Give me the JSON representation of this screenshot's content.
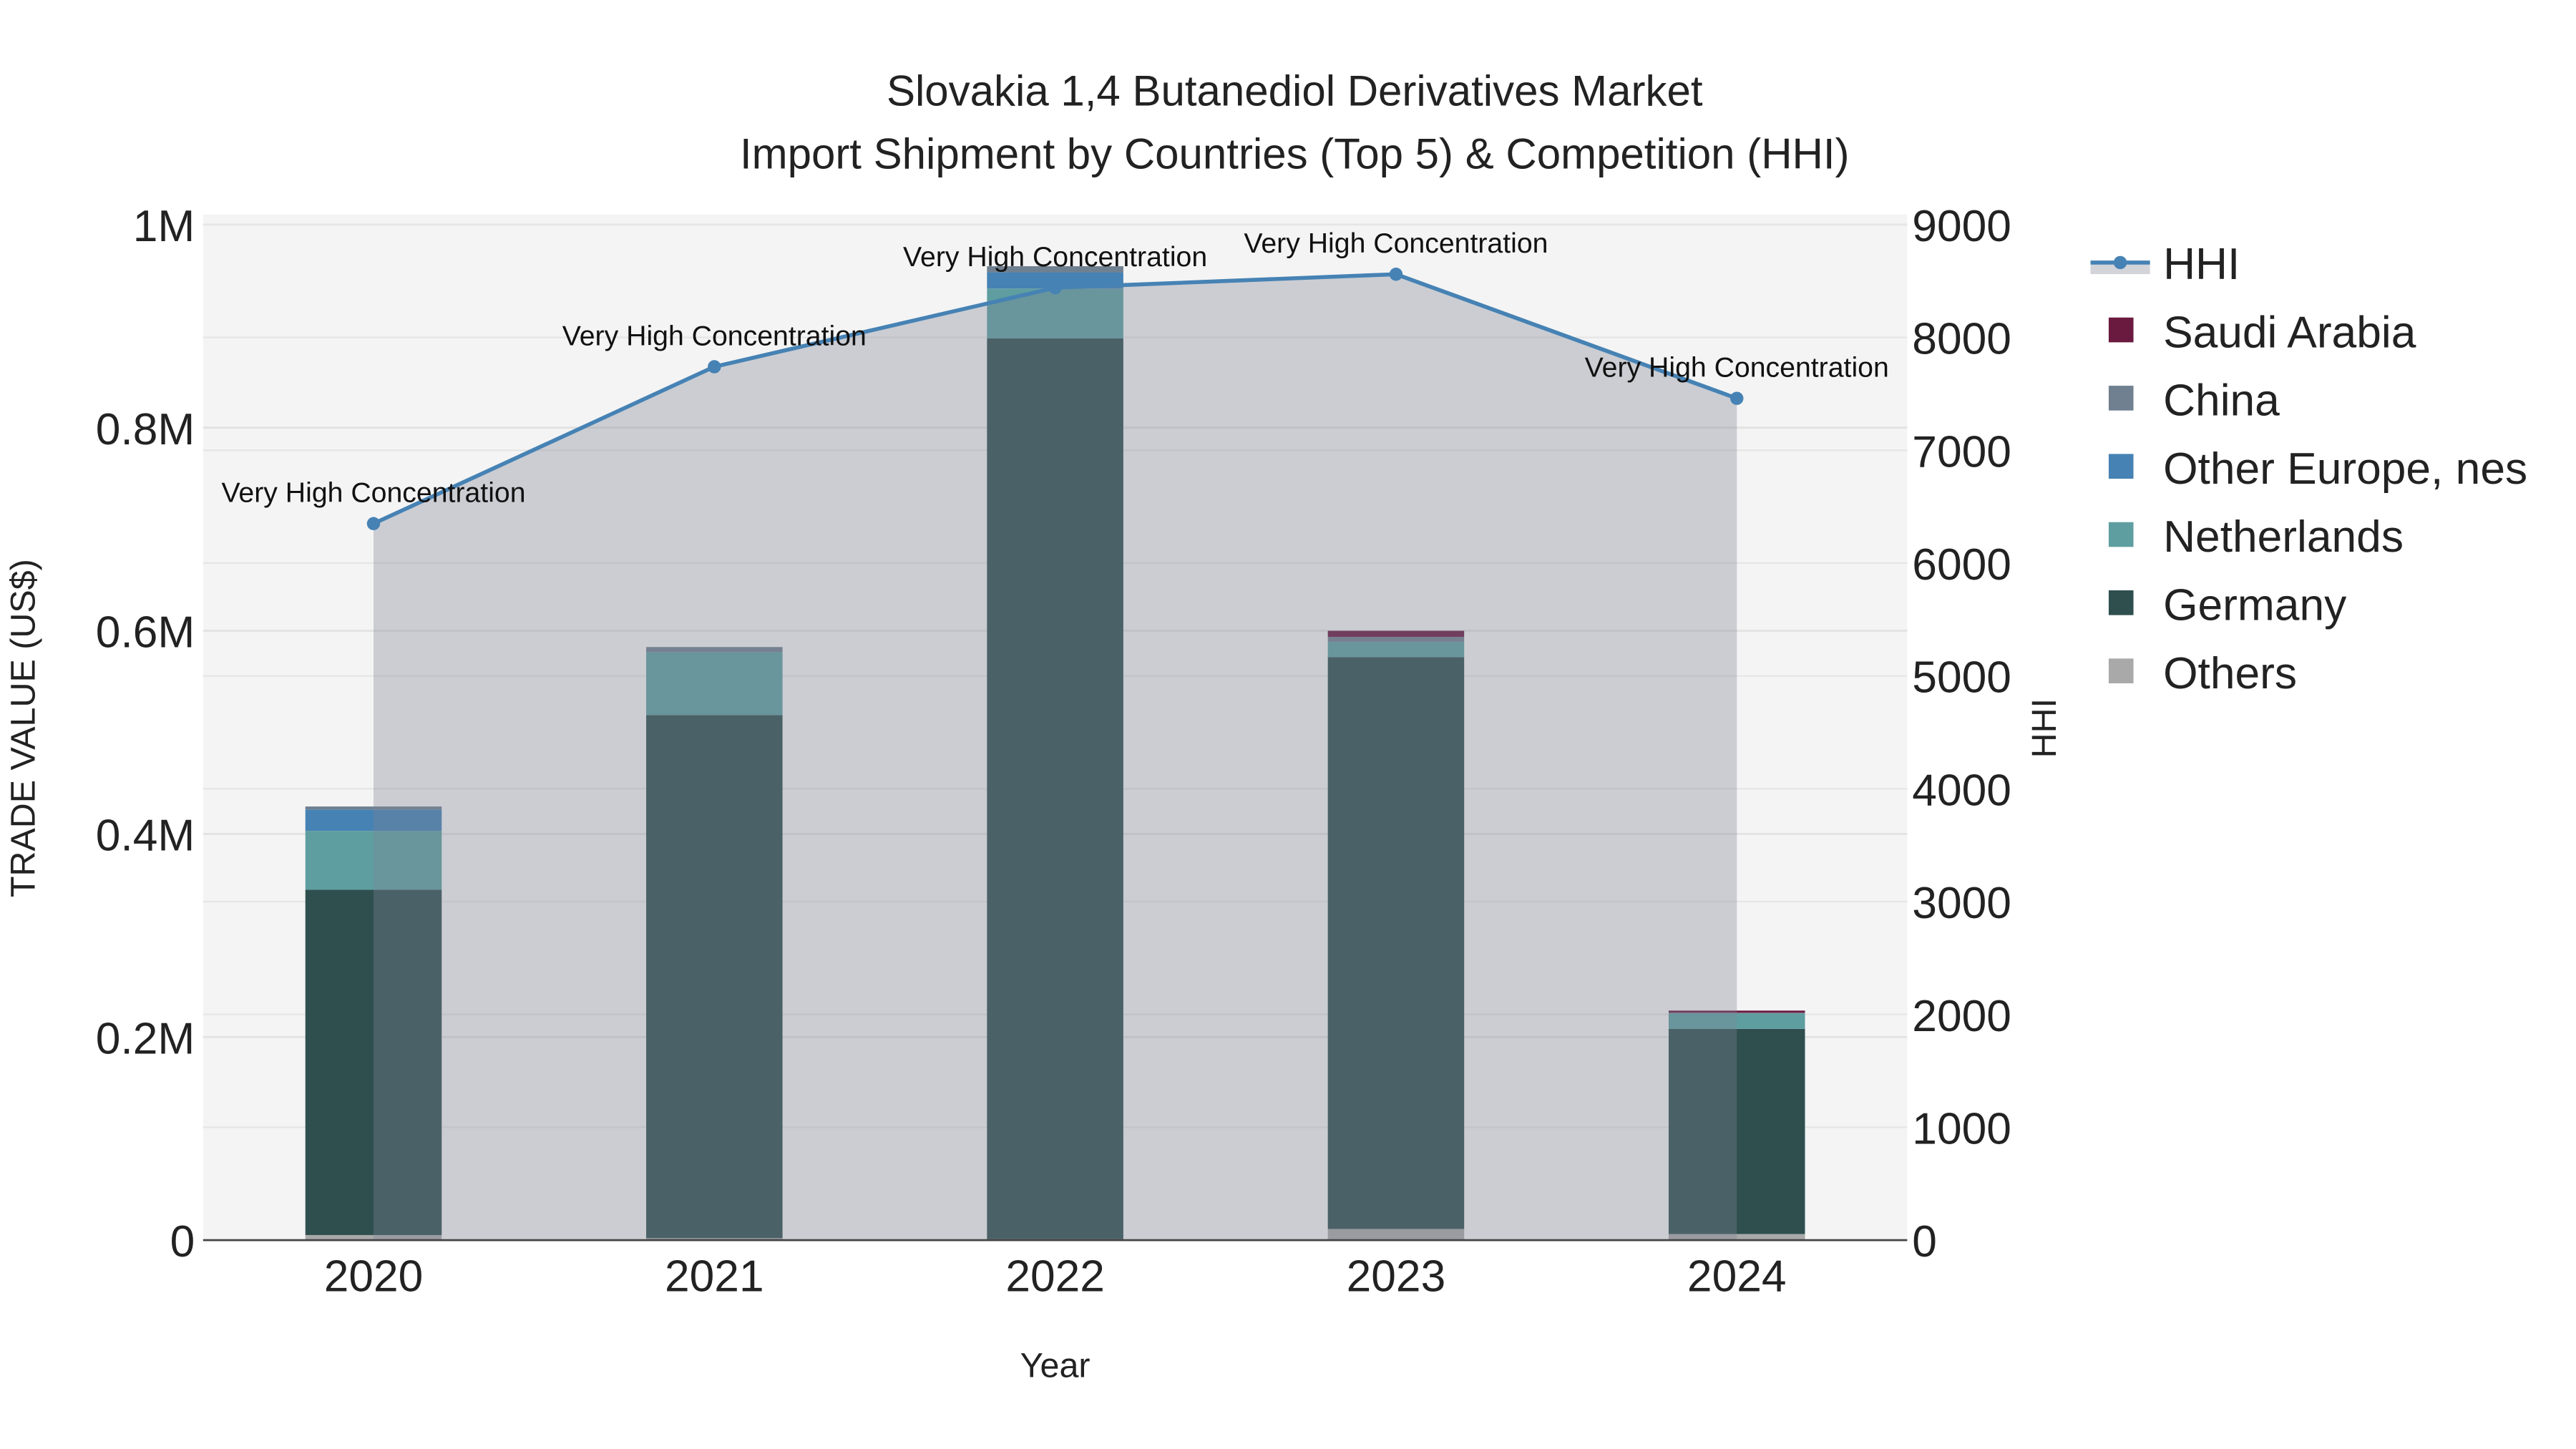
{
  "chart_data": {
    "type": "bar",
    "title": "Slovakia 1,4 Butanediol Derivatives Market",
    "subtitle": "Import Shipment by Countries (Top 5) & Competition (HHI)",
    "xlabel": "Year",
    "ylabel": "TRADE VALUE (US$)",
    "y2label": "HHI",
    "categories": [
      "2020",
      "2021",
      "2022",
      "2023",
      "2024"
    ],
    "ylim": [
      0,
      1000000
    ],
    "y_ticks": [
      0,
      200000,
      400000,
      600000,
      800000,
      1000000
    ],
    "y_tick_labels": [
      "0",
      "0.2M",
      "0.4M",
      "0.6M",
      "0.8M",
      "1M"
    ],
    "y2lim": [
      0,
      9000
    ],
    "y2_ticks": [
      0,
      1000,
      2000,
      3000,
      4000,
      5000,
      6000,
      7000,
      8000,
      9000
    ],
    "y2_tick_labels": [
      "0",
      "1000",
      "2000",
      "3000",
      "4000",
      "5000",
      "6000",
      "7000",
      "8000",
      "9000"
    ],
    "grid": true,
    "legend_placement": "right",
    "series": [
      {
        "name": "Others",
        "color": "#a9a9a9",
        "values": [
          5000,
          2000,
          1000,
          11000,
          6000
        ]
      },
      {
        "name": "Germany",
        "color": "#2f4f4f",
        "values": [
          340000,
          515000,
          887000,
          563000,
          202000
        ]
      },
      {
        "name": "Netherlands",
        "color": "#5f9ea0",
        "values": [
          58000,
          62000,
          49000,
          15000,
          15000
        ]
      },
      {
        "name": "Other Europe, nes",
        "color": "#4682b4",
        "values": [
          21000,
          0,
          16000,
          0,
          0
        ]
      },
      {
        "name": "China",
        "color": "#708090",
        "values": [
          3000,
          5000,
          6000,
          5000,
          1000
        ]
      },
      {
        "name": "Saudi Arabia",
        "color": "#6b1a3f",
        "values": [
          0,
          0,
          0,
          6000,
          2000
        ]
      }
    ],
    "hhi": {
      "name": "HHI",
      "color": "#4682b4",
      "values": [
        6350,
        7740,
        8440,
        8560,
        7460
      ],
      "annotations": [
        "Very High Concentration",
        "Very High Concentration",
        "Very High Concentration",
        "Very High Concentration",
        "Very High Concentration"
      ]
    },
    "legend": [
      "HHI",
      "Saudi Arabia",
      "China",
      "Other Europe, nes",
      "Netherlands",
      "Germany",
      "Others"
    ]
  }
}
